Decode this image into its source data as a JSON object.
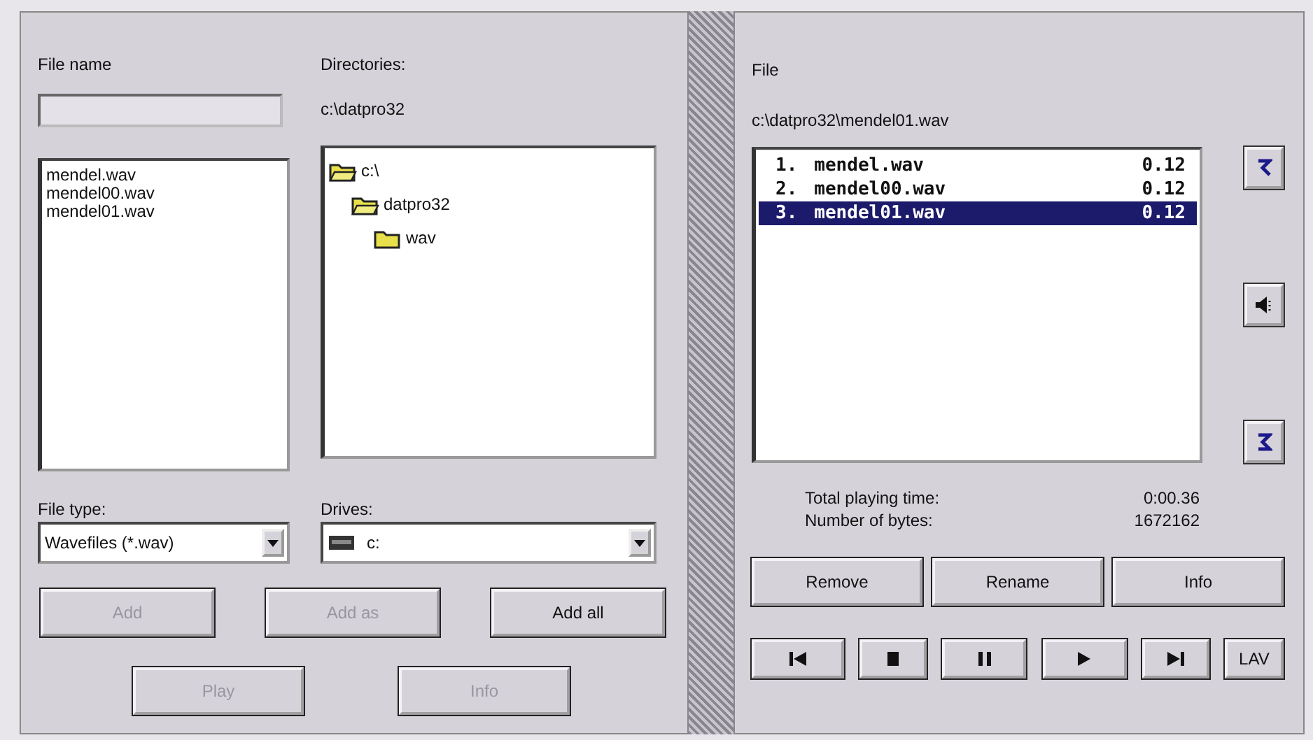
{
  "source": {
    "file_name_label": "File name",
    "directories_label": "Directories:",
    "directory_path": "c:\\datpro32",
    "files": [
      {
        "name": "mendel.wav",
        "selected": false
      },
      {
        "name": "mendel00.wav",
        "selected": false
      },
      {
        "name": "mendel01.wav",
        "selected": false
      }
    ],
    "tree": [
      {
        "name": "c:\\",
        "expanded": true,
        "children": [
          {
            "name": "datpro32",
            "expanded": true,
            "children": [
              {
                "name": "wav",
                "expanded": false
              }
            ]
          }
        ]
      }
    ],
    "file_type_label": "File type:",
    "file_type": "Wavefiles (*.wav)",
    "drives_label": "Drives:",
    "drive": "c:",
    "buttons": [
      {
        "label": "Add",
        "disabled": true
      },
      {
        "label": "Add as",
        "disabled": true
      },
      {
        "label": "Add all",
        "disabled": false
      }
    ],
    "bottom_buttons": [
      {
        "label": "Play",
        "disabled": true
      },
      {
        "label": "Info",
        "disabled": true
      }
    ]
  },
  "playlist": {
    "file_label": "File",
    "file_path": "c:\\datpro32\\mendel01.wav",
    "items": [
      {
        "number": "1.",
        "name": "mendel.wav",
        "time": "0.12",
        "selected": false
      },
      {
        "number": "2.",
        "name": "mendel00.wav",
        "time": "0.12",
        "selected": false
      },
      {
        "number": "3.",
        "name": "mendel01.wav",
        "time": "0.12",
        "selected": true
      }
    ],
    "side_buttons": [
      {
        "kind": "up"
      },
      {
        "kind": "speaker"
      },
      {
        "kind": "down"
      }
    ],
    "stats": [
      {
        "label": "Total playing time:",
        "value": "0:00.36"
      },
      {
        "label": "Number of bytes:",
        "value": "1672162"
      }
    ],
    "buttons": [
      {
        "label": "Remove"
      },
      {
        "label": "Rename"
      },
      {
        "label": "Info"
      }
    ],
    "transport": [
      {
        "kind": "first"
      },
      {
        "kind": "stop"
      },
      {
        "kind": "pause"
      },
      {
        "kind": "play"
      },
      {
        "kind": "last"
      },
      {
        "kind": "text",
        "label": "LAV"
      }
    ]
  }
}
